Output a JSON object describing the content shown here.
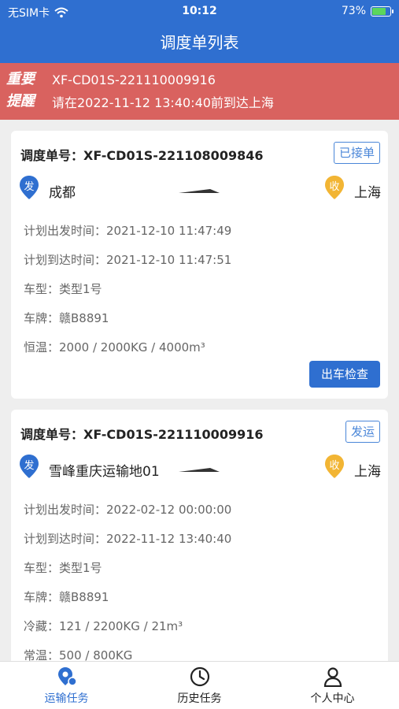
{
  "status_bar": {
    "carrier": "无SIM卡",
    "time": "10:12",
    "battery": "73%"
  },
  "header": {
    "title": "调度单列表"
  },
  "notice": {
    "badge_line1": "重要",
    "badge_line2": "提醒",
    "order_no": "XF-CD01S-221110009916",
    "message": "请在2022-11-12 13:40:40前到达上海"
  },
  "orders": [
    {
      "order_label": "调度单号：",
      "order_no": "XF-CD01S-221108009846",
      "status": "已接单",
      "origin_tag": "发",
      "origin": "成都",
      "dest_tag": "收",
      "dest": "上海",
      "rows": [
        {
          "label": "计划出发时间：",
          "value": "2021-12-10 11:47:49"
        },
        {
          "label": "计划到达时间：",
          "value": "2021-12-10 11:47:51"
        },
        {
          "label": "车型：",
          "value": "类型1号"
        },
        {
          "label": "车牌：",
          "value": "赣B8891"
        },
        {
          "label": "恒温：",
          "value": "2000 / 2000KG / 4000m³"
        }
      ],
      "action": "出车检查"
    },
    {
      "order_label": "调度单号：",
      "order_no": "XF-CD01S-221110009916",
      "status": "发运",
      "origin_tag": "发",
      "origin": "雪峰重庆运输地01",
      "dest_tag": "收",
      "dest": "上海",
      "rows": [
        {
          "label": "计划出发时间：",
          "value": "2022-02-12 00:00:00"
        },
        {
          "label": "计划到达时间：",
          "value": "2022-11-12 13:40:40"
        },
        {
          "label": "车型：",
          "value": "类型1号"
        },
        {
          "label": "车牌：",
          "value": "赣B8891"
        },
        {
          "label": "冷藏：",
          "value": "121 / 2200KG / 21m³"
        },
        {
          "label": "常温：",
          "value": "500 / 800KG"
        }
      ]
    }
  ],
  "tabs": [
    {
      "label": "运输任务",
      "icon": "truck-location-icon",
      "active": true
    },
    {
      "label": "历史任务",
      "icon": "clock-icon",
      "active": false
    },
    {
      "label": "个人中心",
      "icon": "user-icon",
      "active": false
    }
  ],
  "colors": {
    "primary": "#2f6fd0",
    "notice_bg": "#d9625f",
    "origin_pin": "#2f6fd0",
    "dest_pin": "#f2b534"
  }
}
